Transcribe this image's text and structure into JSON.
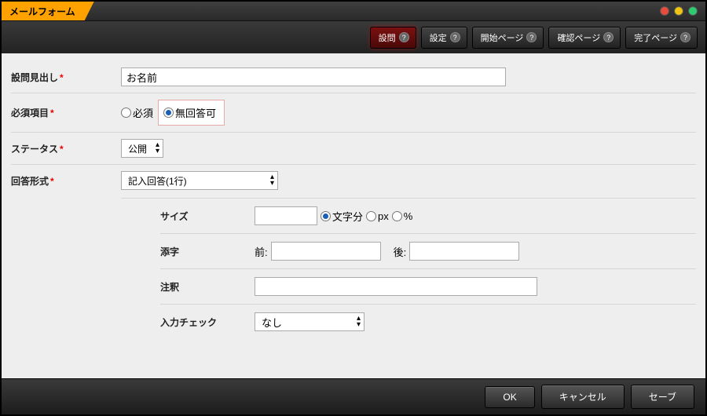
{
  "window": {
    "title": "メールフォーム"
  },
  "tabs": {
    "items": [
      {
        "label": "設問",
        "active": true
      },
      {
        "label": "設定",
        "active": false
      },
      {
        "label": "開始ページ",
        "active": false
      },
      {
        "label": "確認ページ",
        "active": false
      },
      {
        "label": "完了ページ",
        "active": false
      }
    ]
  },
  "form": {
    "heading_label": "設問見出し",
    "heading_value": "お名前",
    "required_label": "必須項目",
    "required_options": {
      "required": "必須",
      "optional": "無回答可"
    },
    "required_selected": "optional",
    "status_label": "ステータス",
    "status_value": "公開",
    "answer_type_label": "回答形式",
    "answer_type_value": "記入回答(1行)",
    "size_label": "サイズ",
    "size_value": "",
    "size_units": {
      "chars": "文字分",
      "px": "px",
      "percent": "%"
    },
    "size_unit_selected": "chars",
    "affix_label": "添字",
    "affix_before_label": "前:",
    "affix_before_value": "",
    "affix_after_label": "後:",
    "affix_after_value": "",
    "note_label": "注釈",
    "note_value": "",
    "check_label": "入力チェック",
    "check_value": "なし"
  },
  "footer": {
    "ok": "OK",
    "cancel": "キャンセル",
    "save": "セーブ"
  },
  "req_mark": "*"
}
